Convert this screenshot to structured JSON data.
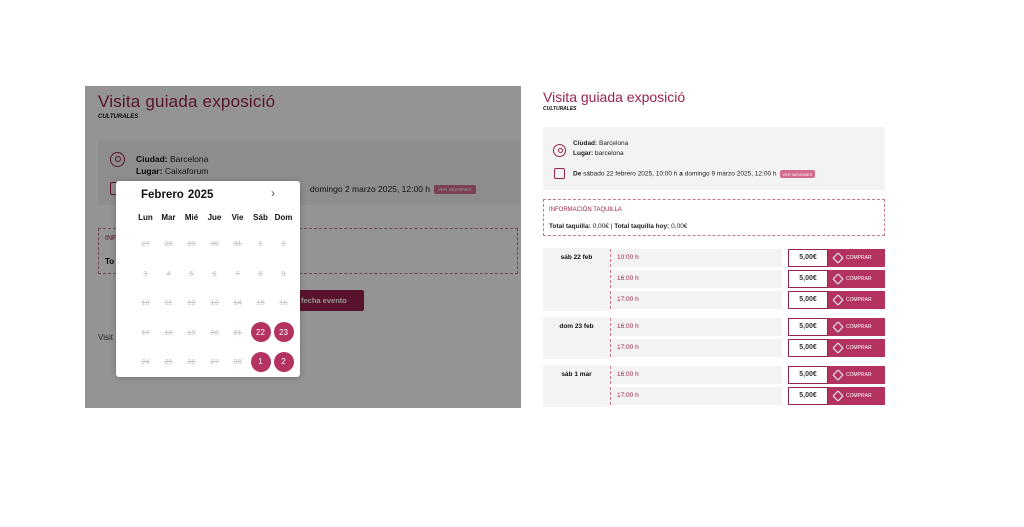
{
  "left": {
    "title": "Visita guiada exposició",
    "subtitle": "CULTURALES",
    "city_label": "Ciudad:",
    "city_value": "Barcelona",
    "place_label": "Lugar:",
    "place_value": "Caixaforum",
    "date_text": "domingo 2 marzo 2025, 12:00 h",
    "date_tag": "VER SESIONES",
    "info_head": "INF",
    "info_line": "To",
    "select_button": "r fecha evento",
    "visit_text": "Visit"
  },
  "picker": {
    "month": "Febrero",
    "year": "2025",
    "next": "›",
    "weekdays": [
      "Lun",
      "Mar",
      "Mié",
      "Jue",
      "Vie",
      "Sáb",
      "Dom"
    ],
    "days": [
      {
        "n": "27",
        "on": false
      },
      {
        "n": "28",
        "on": false
      },
      {
        "n": "29",
        "on": false
      },
      {
        "n": "30",
        "on": false
      },
      {
        "n": "31",
        "on": false
      },
      {
        "n": "1",
        "on": false
      },
      {
        "n": "2",
        "on": false
      },
      {
        "n": "3",
        "on": false
      },
      {
        "n": "4",
        "on": false
      },
      {
        "n": "5",
        "on": false
      },
      {
        "n": "6",
        "on": false
      },
      {
        "n": "7",
        "on": false
      },
      {
        "n": "8",
        "on": false
      },
      {
        "n": "9",
        "on": false
      },
      {
        "n": "10",
        "on": false
      },
      {
        "n": "11",
        "on": false
      },
      {
        "n": "12",
        "on": false
      },
      {
        "n": "13",
        "on": false
      },
      {
        "n": "14",
        "on": false
      },
      {
        "n": "15",
        "on": false
      },
      {
        "n": "16",
        "on": false
      },
      {
        "n": "17",
        "on": false
      },
      {
        "n": "18",
        "on": false
      },
      {
        "n": "19",
        "on": false
      },
      {
        "n": "20",
        "on": false
      },
      {
        "n": "21",
        "on": false
      },
      {
        "n": "22",
        "on": true
      },
      {
        "n": "23",
        "on": true
      },
      {
        "n": "24",
        "on": false
      },
      {
        "n": "25",
        "on": false
      },
      {
        "n": "26",
        "on": false
      },
      {
        "n": "27",
        "on": false
      },
      {
        "n": "28",
        "on": false
      },
      {
        "n": "1",
        "on": true
      },
      {
        "n": "2",
        "on": true
      }
    ]
  },
  "right": {
    "title": "Visita guiada exposició",
    "subtitle": "CULTURALES",
    "city_label": "Ciudad:",
    "city_value": "Barcelona",
    "place_label": "Lugar:",
    "place_value": "barcelona",
    "date_prefix": "De",
    "date_from": "sábado 22 febrero 2025, 10:00 h",
    "date_mid": "a",
    "date_to": "domingo 9 marzo 2025, 12:00 h",
    "date_tag": "VER SESIONES",
    "info_head": "INFORMACIÓN TAQUILLA",
    "total_label": "Total taquilla:",
    "total_value": "0,00€",
    "sep": "|",
    "today_label": "Total taquilla hoy:",
    "today_value": "0,00€",
    "buy_label": "COMPRAR",
    "schedule": [
      {
        "day": "sáb 22 feb",
        "sessions": [
          {
            "time": "10:00 h",
            "price": "5,00€"
          },
          {
            "time": "16:00 h",
            "price": "5,00€"
          },
          {
            "time": "17:00 h",
            "price": "5,00€"
          }
        ]
      },
      {
        "day": "dom 23 feb",
        "sessions": [
          {
            "time": "16:00 h",
            "price": "5,00€"
          },
          {
            "time": "17:00 h",
            "price": "5,00€"
          }
        ]
      },
      {
        "day": "sáb 1 mar",
        "sessions": [
          {
            "time": "16:00 h",
            "price": "5,00€"
          },
          {
            "time": "17:00 h",
            "price": "5,00€"
          }
        ]
      }
    ]
  },
  "colors": {
    "accent": "#9a2250",
    "button": "#b3325f",
    "tag": "#d46b8f",
    "panel": "#f3f3f3"
  }
}
